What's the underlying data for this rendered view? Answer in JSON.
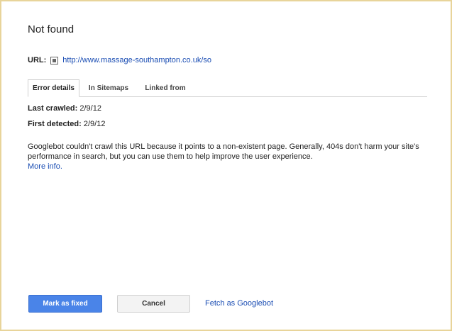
{
  "dialog": {
    "title": "Not found",
    "url_label": "URL:",
    "url": "http://www.massage-southampton.co.uk/so"
  },
  "tabs": [
    {
      "label": "Error details",
      "active": true
    },
    {
      "label": "In Sitemaps",
      "active": false
    },
    {
      "label": "Linked from",
      "active": false
    }
  ],
  "details": {
    "last_crawled_label": "Last crawled:",
    "last_crawled_value": "2/9/12",
    "first_detected_label": "First detected:",
    "first_detected_value": "2/9/12"
  },
  "description": {
    "text": "Googlebot couldn't crawl this URL because it points to a non-existent page. Generally, 404s don't harm your site's performance in search, but you can use them to help improve the user experience.",
    "more_link": "More info."
  },
  "actions": {
    "mark_fixed": "Mark as fixed",
    "cancel": "Cancel",
    "fetch": "Fetch as Googlebot"
  },
  "colors": {
    "link": "#1a4db3",
    "primary_button": "#4a84e8",
    "border": "#e8d49a"
  },
  "icons": {
    "external_link": "external-link-icon"
  }
}
